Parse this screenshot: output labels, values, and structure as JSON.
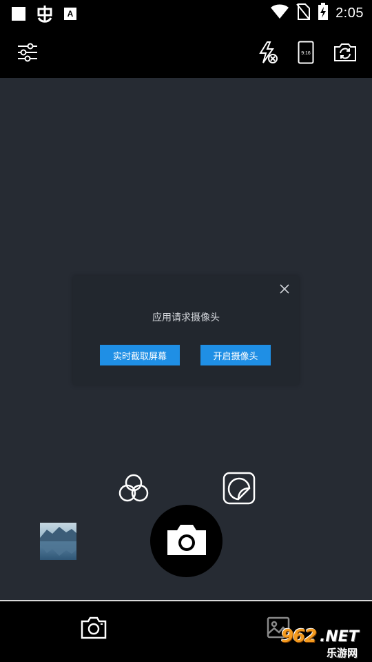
{
  "status_bar": {
    "time": "2:05",
    "icons": [
      "square-notification-icon",
      "bug-icon",
      "a-keyboard-icon",
      "wifi-icon",
      "no-sim-icon",
      "battery-charging-icon"
    ]
  },
  "toolbar": {
    "icons": [
      "settings-sliders-icon",
      "flash-off-icon",
      "aspect-ratio-icon",
      "switch-camera-icon"
    ],
    "aspect_ratio": "9:16"
  },
  "dialog": {
    "message": "应用请求摄像头",
    "capture_screen_label": "实时截取屏幕",
    "open_camera_label": "开启摄像头"
  },
  "controls": {
    "icons": [
      "filter-icon",
      "sticker-icon",
      "gallery-thumbnail",
      "shutter-camera-icon"
    ]
  },
  "bottom_nav": {
    "icons": [
      "camera-tab-icon",
      "gallery-tab-icon"
    ]
  },
  "watermark": {
    "number": "962",
    "net": ".NET",
    "cn": "乐游网"
  },
  "colors": {
    "preview_bg": "#262b33",
    "dialog_bg": "#22272e",
    "accent": "#1f8fe5"
  }
}
